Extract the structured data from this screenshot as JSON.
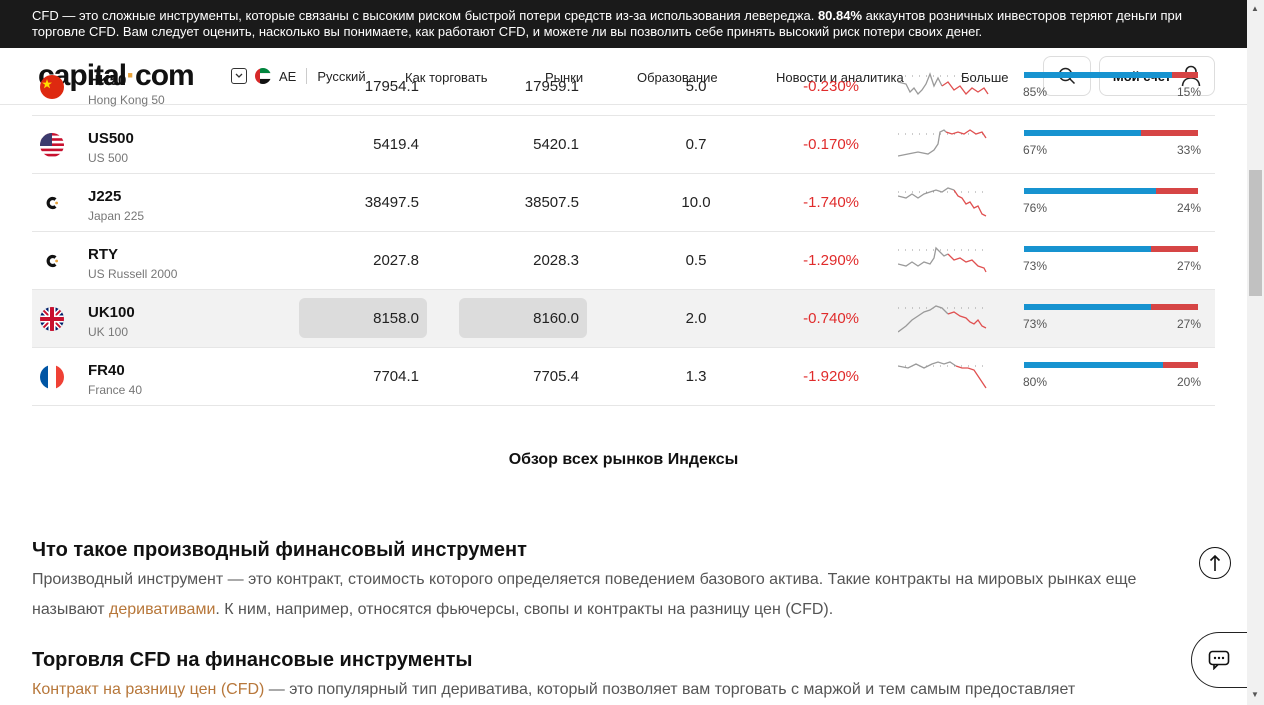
{
  "risk_banner": {
    "text_a": "CFD — это сложные инструменты, которые связаны с высоким риском быстрой потери средств из-за использования левереджа. ",
    "percent": "80.84%",
    "text_b": " аккаунтов розничных инвесторов теряют деньги при торговле CFD. Вам следует оценить, насколько вы понимаете, как работают CFD, и можете ли вы позволить себе принять высокий риск потери своих денег."
  },
  "header": {
    "logo_left": "capital",
    "logo_dot": "·",
    "logo_right": "com",
    "region_code": "AE",
    "language": "Русский",
    "nav": [
      "Как торговать",
      "Рынки",
      "Образование",
      "Новости и аналитика",
      "Больше"
    ],
    "account_label": "Мой счет"
  },
  "markets": [
    {
      "symbol": "HK50",
      "name": "Hong Kong 50",
      "sell": "17954.1",
      "buy": "17959.1",
      "spread": "5.0",
      "change": "-0.230%",
      "buyers_pct": "85%",
      "sellers_pct": "15%",
      "buyers_frac": 0.85,
      "flag": "china"
    },
    {
      "symbol": "US500",
      "name": "US 500",
      "sell": "5419.4",
      "buy": "5420.1",
      "spread": "0.7",
      "change": "-0.170%",
      "buyers_pct": "67%",
      "sellers_pct": "33%",
      "buyers_frac": 0.67,
      "flag": "usa"
    },
    {
      "symbol": "J225",
      "name": "Japan 225",
      "sell": "38497.5",
      "buy": "38507.5",
      "spread": "10.0",
      "change": "-1.740%",
      "buyers_pct": "76%",
      "sellers_pct": "24%",
      "buyers_frac": 0.76,
      "flag": "capital"
    },
    {
      "symbol": "RTY",
      "name": "US Russell 2000",
      "sell": "2027.8",
      "buy": "2028.3",
      "spread": "0.5",
      "change": "-1.290%",
      "buyers_pct": "73%",
      "sellers_pct": "27%",
      "buyers_frac": 0.73,
      "flag": "capital"
    },
    {
      "symbol": "UK100",
      "name": "UK 100",
      "sell": "8158.0",
      "buy": "8160.0",
      "spread": "2.0",
      "change": "-0.740%",
      "buyers_pct": "73%",
      "sellers_pct": "27%",
      "buyers_frac": 0.73,
      "flag": "uk"
    },
    {
      "symbol": "FR40",
      "name": "France 40",
      "sell": "7704.1",
      "buy": "7705.4",
      "spread": "1.3",
      "change": "-1.920%",
      "buyers_pct": "80%",
      "sellers_pct": "20%",
      "buyers_frac": 0.8,
      "flag": "france"
    }
  ],
  "overview_link": "Обзор всех рынков Индексы",
  "sections": {
    "s1_title": "Что такое производный финансовый инструмент",
    "s1_text_a": "Производный инструмент — это контракт, стоимость которого определяется поведением базового актива. Такие контракты на мировых рынках еще называют ",
    "s1_link": "деривативами",
    "s1_text_b": ". К ним, например, относятся фьючерсы, свопы и контракты на разницу цен (CFD).",
    "s2_title": "Торговля CFD на финансовые инструменты",
    "s2_link": "Контракт на разницу цен (CFD)",
    "s2_text": " — это популярный тип дериватива, который позволяет вам торговать с маржой и тем самым предоставляет"
  },
  "colors": {
    "buyers": "#1793d0",
    "sellers": "#d64545",
    "negative": "#e02b2b",
    "link": "#b7773a",
    "logo_dot": "#e8a33b"
  }
}
